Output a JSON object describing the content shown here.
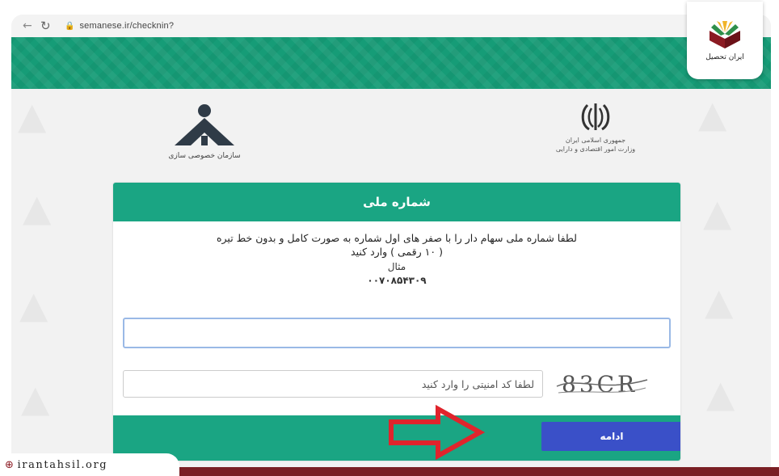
{
  "browser": {
    "back_icon": "arrow-left-icon",
    "reload_icon": "reload-icon",
    "lock_icon": "lock-icon",
    "url": "semanese.ir/checknin?"
  },
  "header": {
    "left_org_caption": "سازمان خصوصی سازی",
    "right_gov_line1": "جمهوری اسلامی ایران",
    "right_gov_line2": "وزارت امور اقتصادی و دارایی"
  },
  "form": {
    "title": "شماره ملی",
    "instruction_line1": "لطفا شماره ملی سهام دار را با صفر های اول شماره به صورت کامل و بدون خط تیره",
    "instruction_line2": "( ۱۰ رقمی ) وارد کنید",
    "example_label": "مثال",
    "example_value": "۰۰۷۰۸۵۴۳۰۹",
    "national_id_value": "",
    "captcha_placeholder": "لطفا کد امنیتی را وارد کنید",
    "captcha_text": "83CR",
    "submit_label": "ادامه"
  },
  "watermark": {
    "brand": "ایران تحصیل",
    "site": "irantahsil.org"
  },
  "colors": {
    "green": "#1aa583",
    "header_green": "#169c77",
    "button_blue": "#3a50c8",
    "arrow_red": "#e0242c",
    "band_red": "#7a1f24"
  }
}
